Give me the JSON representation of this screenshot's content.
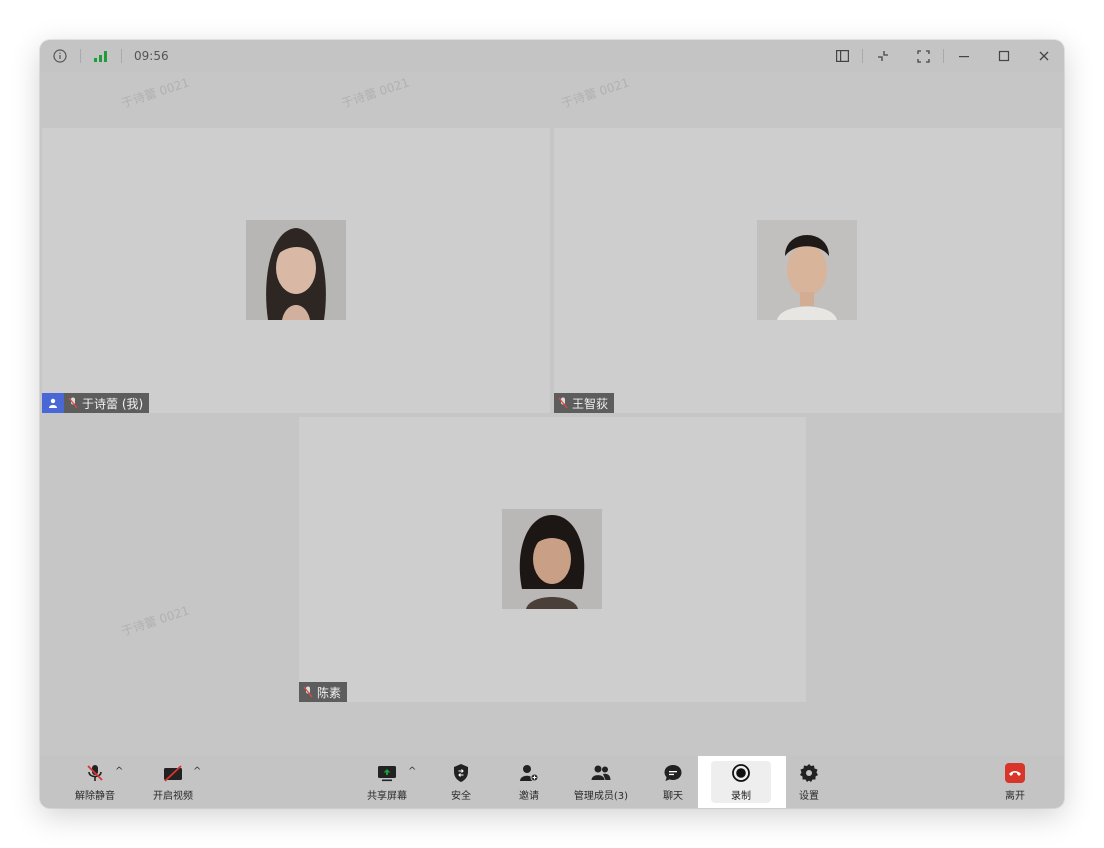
{
  "titlebar": {
    "time": "09:56",
    "left_icons": [
      "info-icon",
      "signal-icon"
    ],
    "right_icons": [
      "sidebar-layout-icon",
      "exit-fullscreen-icon",
      "fullscreen-icon",
      "minimize-icon",
      "maximize-icon",
      "close-icon"
    ]
  },
  "watermark": {
    "text": "于诗蕾 0021"
  },
  "participants": [
    {
      "name": "于诗蕾 (我)",
      "is_me": true,
      "muted": true
    },
    {
      "name": "王智荻",
      "is_me": false,
      "muted": true
    },
    {
      "name": "陈素",
      "is_me": false,
      "muted": true
    }
  ],
  "toolbar": {
    "unmute_label": "解除静音",
    "video_label": "开启视频",
    "share_label": "共享屏幕",
    "security_label": "安全",
    "invite_label": "邀请",
    "members_label": "管理成员(3)",
    "chat_label": "聊天",
    "record_label": "录制",
    "settings_label": "设置",
    "leave_label": "离开",
    "caret": "^"
  },
  "colors": {
    "leave": "#d9362b",
    "me_badge": "#4a67d6",
    "signal": "#1e9e3a"
  }
}
